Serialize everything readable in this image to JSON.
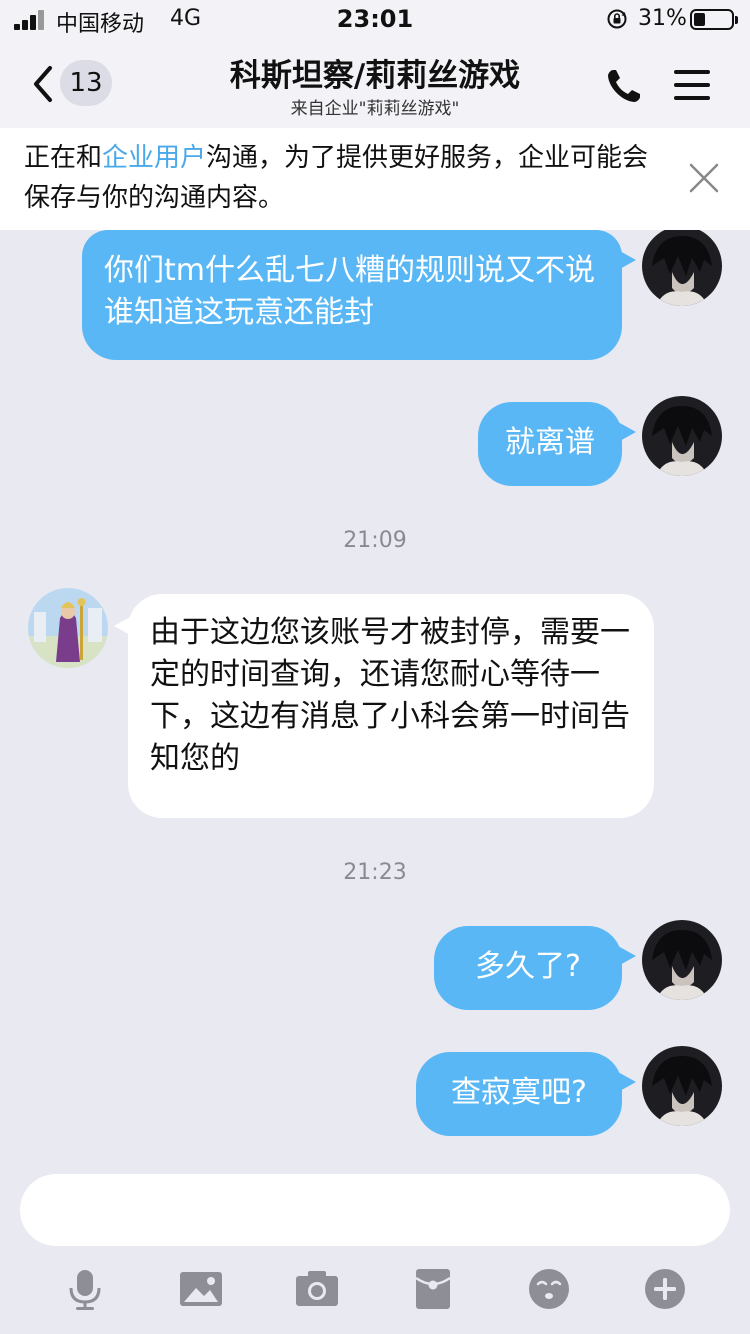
{
  "status_bar": {
    "carrier": "中国移动",
    "network": "4G",
    "time": "23:01",
    "battery_pct": "31%",
    "battery_level": 0.31
  },
  "nav": {
    "back_count": "13",
    "title": "科斯坦察/莉莉丝游戏",
    "subtitle": "来自企业\"莉莉丝游戏\""
  },
  "notice": {
    "prefix": "正在和",
    "link": "企业用户",
    "suffix": "沟通，为了提供更好服务，企业可能会保存与你的沟通内容。"
  },
  "messages": [
    {
      "direction": "out",
      "text": "你们tm什么乱七八糟的规则说又不说谁知道这玩意还能封"
    },
    {
      "direction": "out",
      "text": "就离谱"
    },
    {
      "type": "timestamp",
      "text": "21:09"
    },
    {
      "direction": "in",
      "text": "由于这边您该账号才被封停，需要一定的时间查询，还请您耐心等待一下，这边有消息了小科会第一时间告知您的"
    },
    {
      "type": "timestamp",
      "text": "21:23"
    },
    {
      "direction": "out",
      "text": "多久了?"
    },
    {
      "direction": "out",
      "text": "查寂寞吧?"
    }
  ],
  "toolbar_icons": [
    "microphone-icon",
    "image-icon",
    "camera-icon",
    "red-packet-icon",
    "emoji-icon",
    "plus-icon"
  ],
  "colors": {
    "outgoing_bubble": "#5ab7f6",
    "incoming_bubble": "#ffffff",
    "link": "#4aa9e8",
    "background": "#e9e9f1"
  }
}
